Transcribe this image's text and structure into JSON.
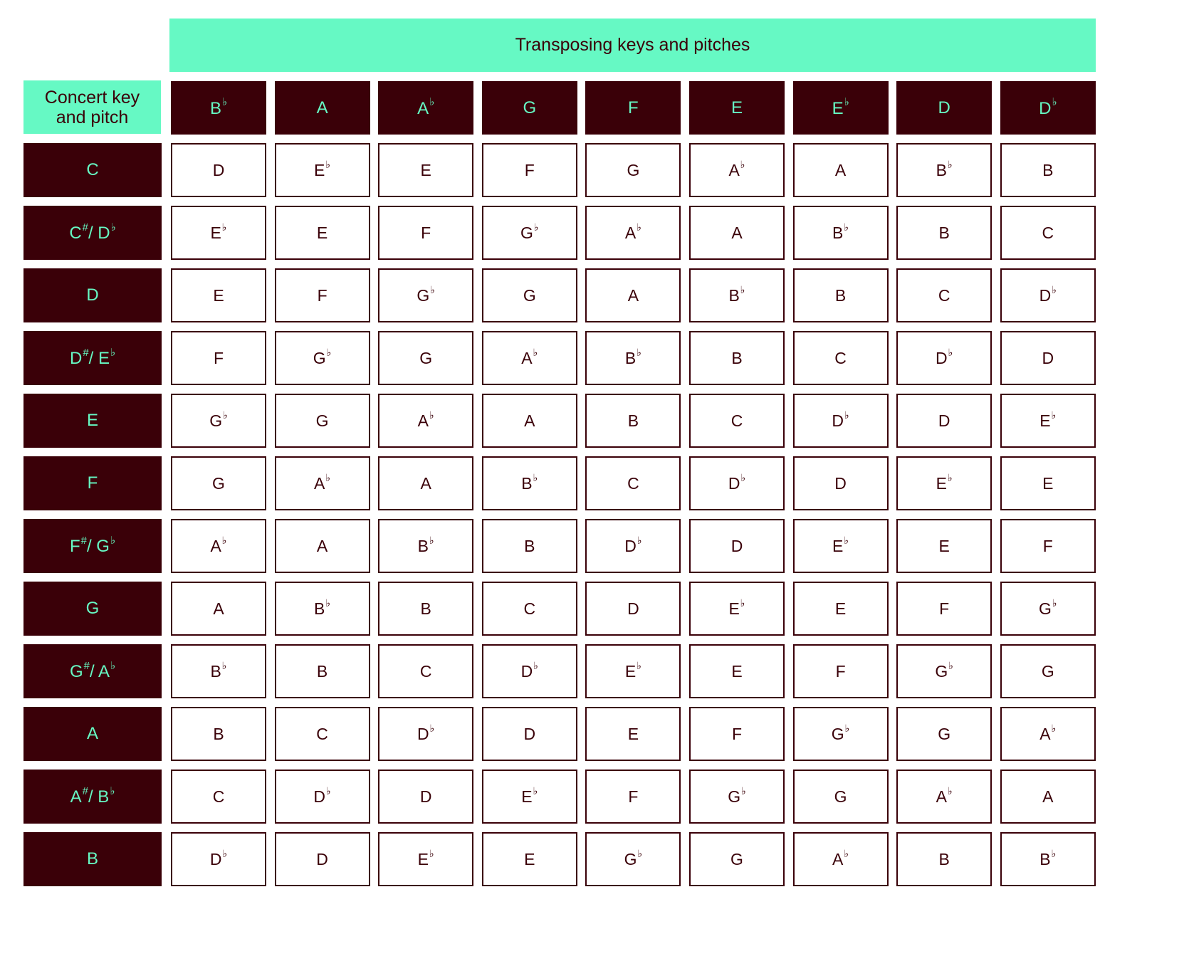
{
  "chart_data": {
    "type": "table",
    "title": "Transposing keys and pitches",
    "row_header_label": "Concert key and pitch",
    "columns": [
      "B♭",
      "A",
      "A♭",
      "G",
      "F",
      "E",
      "E♭",
      "D",
      "D♭"
    ],
    "rows": [
      {
        "key": "C",
        "values": [
          "D",
          "E♭",
          "E",
          "F",
          "G",
          "A♭",
          "A",
          "B♭",
          "B"
        ]
      },
      {
        "key": "C♯/ D♭",
        "values": [
          "E♭",
          "E",
          "F",
          "G♭",
          "A♭",
          "A",
          "B♭",
          "B",
          "C"
        ]
      },
      {
        "key": "D",
        "values": [
          "E",
          "F",
          "G♭",
          "G",
          "A",
          "B♭",
          "B",
          "C",
          "D♭"
        ]
      },
      {
        "key": "D♯/ E♭",
        "values": [
          "F",
          "G♭",
          "G",
          "A♭",
          "B♭",
          "B",
          "C",
          "D♭",
          "D"
        ]
      },
      {
        "key": "E",
        "values": [
          "G♭",
          "G",
          "A♭",
          "A",
          "B",
          "C",
          "D♭",
          "D",
          "E♭"
        ]
      },
      {
        "key": "F",
        "values": [
          "G",
          "A♭",
          "A",
          "B♭",
          "C",
          "D♭",
          "D",
          "E♭",
          "E"
        ]
      },
      {
        "key": "F♯/ G♭",
        "values": [
          "A♭",
          "A",
          "B♭",
          "B",
          "D♭",
          "D",
          "E♭",
          "E",
          "F"
        ]
      },
      {
        "key": "G",
        "values": [
          "A",
          "B♭",
          "B",
          "C",
          "D",
          "E♭",
          "E",
          "F",
          "G♭"
        ]
      },
      {
        "key": "G♯/ A♭",
        "values": [
          "B♭",
          "B",
          "C",
          "D♭",
          "E♭",
          "E",
          "F",
          "G♭",
          "G"
        ]
      },
      {
        "key": "A",
        "values": [
          "B",
          "C",
          "D♭",
          "D",
          "E",
          "F",
          "G♭",
          "G",
          "A♭"
        ]
      },
      {
        "key": "A♯/ B♭",
        "values": [
          "C",
          "D♭",
          "D",
          "E♭",
          "F",
          "G♭",
          "G",
          "A♭",
          "A"
        ]
      },
      {
        "key": "B",
        "values": [
          "D♭",
          "D",
          "E♭",
          "E",
          "G♭",
          "G",
          "A♭",
          "B",
          "B♭"
        ]
      }
    ]
  },
  "colors": {
    "accent_mint": "#66f9c4",
    "dark_maroon": "#3a0008",
    "cell_background": "#ffffff"
  }
}
